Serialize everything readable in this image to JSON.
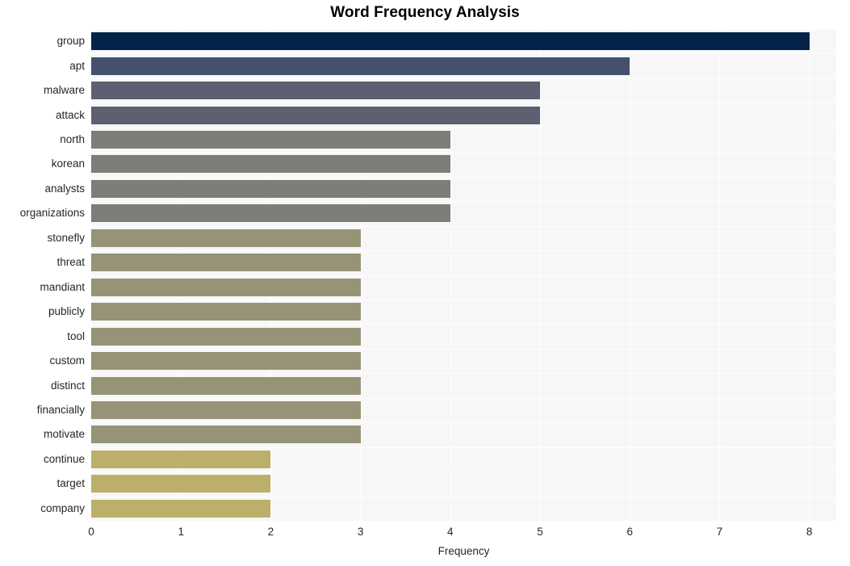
{
  "chart_data": {
    "type": "bar",
    "orientation": "horizontal",
    "title": "Word Frequency Analysis",
    "xlabel": "Frequency",
    "ylabel": "",
    "categories": [
      "group",
      "apt",
      "malware",
      "attack",
      "north",
      "korean",
      "analysts",
      "organizations",
      "stonefly",
      "threat",
      "mandiant",
      "publicly",
      "tool",
      "custom",
      "distinct",
      "financially",
      "motivate",
      "continue",
      "target",
      "company"
    ],
    "values": [
      8,
      6,
      5,
      5,
      4,
      4,
      4,
      4,
      3,
      3,
      3,
      3,
      3,
      3,
      3,
      3,
      3,
      2,
      2,
      2
    ],
    "bar_colors": [
      "#03234b",
      "#454f6e",
      "#5c6070",
      "#5c6070",
      "#7d7d7a",
      "#7d7d7a",
      "#7d7d7a",
      "#7d7d7a",
      "#979377",
      "#979377",
      "#979377",
      "#979377",
      "#979377",
      "#979377",
      "#979377",
      "#979377",
      "#979377",
      "#bcaf6a",
      "#bcaf6a",
      "#bcaf6a"
    ],
    "xticks": [
      "0",
      "1",
      "2",
      "3",
      "4",
      "5",
      "6",
      "7",
      "8"
    ],
    "xlim": [
      0,
      8.3
    ],
    "grid": true,
    "legend": "none",
    "plot_background": "#f7f7f7",
    "gridline_color": "#ffffff",
    "figure_background": "#ffffff"
  }
}
